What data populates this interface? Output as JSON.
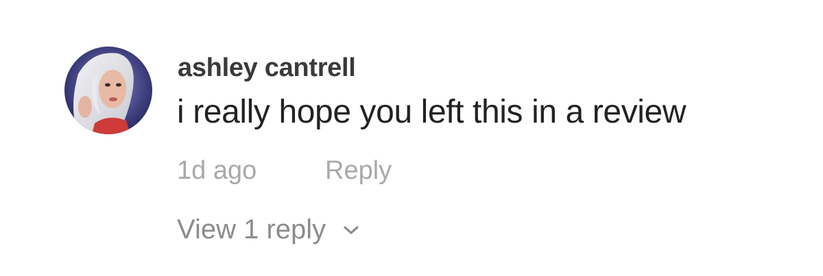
{
  "comment": {
    "username": "ashley cantrell",
    "text": "i really hope you left this in a review",
    "timestamp": "1d ago",
    "reply_label": "Reply",
    "view_replies_label": "View 1 reply",
    "avatar_icon": "user-avatar-photo",
    "expand_icon": "chevron-down-icon"
  }
}
